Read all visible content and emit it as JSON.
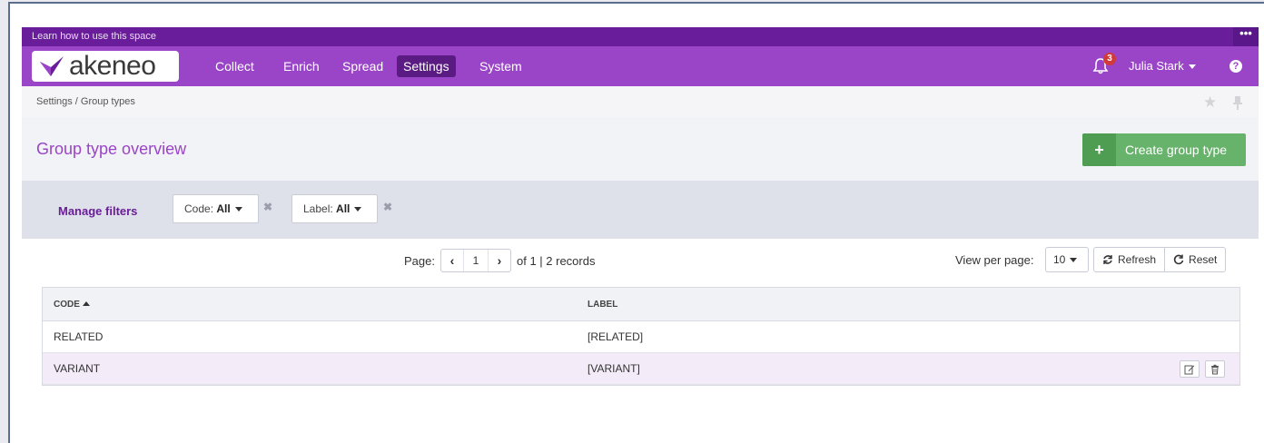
{
  "learn_bar": {
    "text": "Learn how to use this space",
    "menu_label": "•••"
  },
  "logo": {
    "text": "akeneo"
  },
  "nav": {
    "items": [
      {
        "label": "Collect",
        "active": false
      },
      {
        "label": "Enrich",
        "active": false
      },
      {
        "label": "Spread",
        "active": false
      },
      {
        "label": "Settings",
        "active": true
      },
      {
        "label": "System",
        "active": false
      }
    ],
    "notifications_count": "3",
    "user_name": "Julia Stark",
    "help_label": "?"
  },
  "breadcrumb": {
    "text": "Settings / Group types"
  },
  "page": {
    "title": "Group type overview",
    "create_button_icon": "+",
    "create_button_label": "Create group type"
  },
  "filters": {
    "manage_label": "Manage filters",
    "code_prefix": "Code: ",
    "code_value": "All",
    "label_prefix": "Label: ",
    "label_value": "All",
    "remove_icon": "✖"
  },
  "pagination": {
    "page_label": "Page:",
    "prev_icon": "‹",
    "current_page": "1",
    "next_icon": "›",
    "summary": "of 1 | 2 records",
    "view_per_page_label": "View per page:",
    "per_page_value": "10",
    "refresh_label": "Refresh",
    "reset_label": "Reset"
  },
  "table": {
    "columns": [
      "CODE",
      "LABEL"
    ],
    "rows": [
      {
        "code": "RELATED",
        "label": "[RELATED]"
      },
      {
        "code": "VARIANT",
        "label": "[VARIANT]"
      }
    ]
  },
  "colors": {
    "brand_purple": "#9a44c7",
    "learn_bar": "#6a1d9a",
    "create_green": "#67b36b"
  }
}
